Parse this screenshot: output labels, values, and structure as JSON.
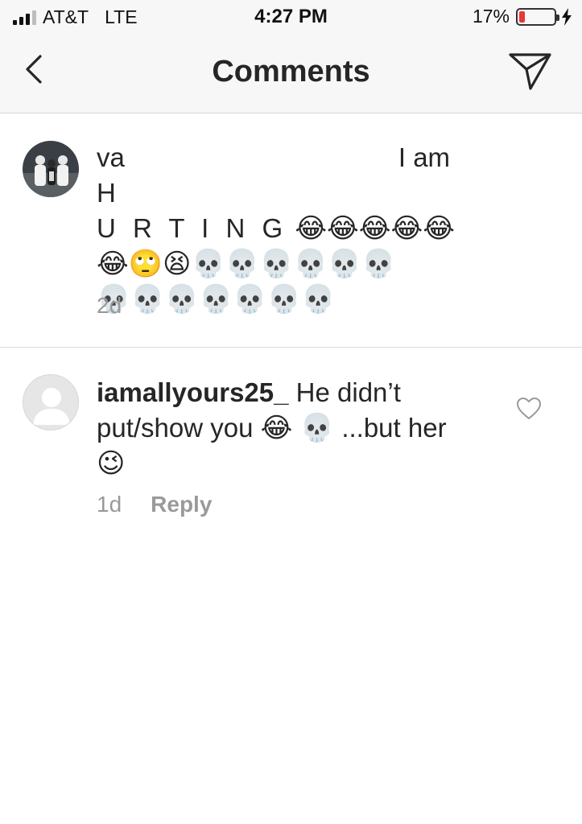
{
  "status_bar": {
    "carrier": "AT&T",
    "network": "LTE",
    "time": "4:27 PM",
    "battery_percent": "17%",
    "battery_level": 0.17,
    "signal_bars_filled": 3,
    "signal_bars_total": 4
  },
  "nav": {
    "title": "Comments"
  },
  "comments": [
    {
      "username": "va",
      "text_1": "I am H",
      "text_2": "U R T I N G",
      "emoji_line_1": "😂😂😂😂😂",
      "emoji_line_2": "😂🙄😫💀💀💀💀💀💀",
      "emoji_line_3": "💀💀💀💀💀💀💀",
      "age": "2d"
    },
    {
      "username": "iamallyours25_",
      "text_1": "He didn’t put/show you",
      "emoji_1": "😂 💀",
      "text_2": "...but her",
      "emoji_2": "😉",
      "age": "1d",
      "reply_label": "Reply"
    }
  ],
  "colors": {
    "bar_background": "#f7f7f7",
    "text": "#262626",
    "muted": "#999999",
    "battery_low": "#e53935"
  }
}
